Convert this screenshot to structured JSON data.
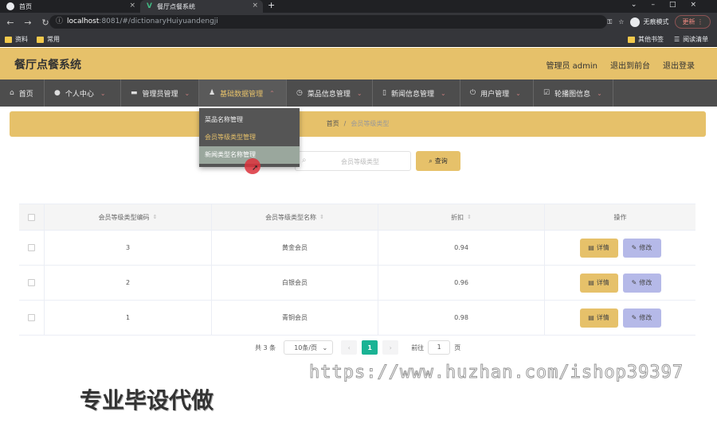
{
  "browser": {
    "tabs": [
      {
        "title": "首页"
      },
      {
        "title": "餐厅点餐系统"
      }
    ],
    "url_host": "localhost",
    "url_path": ":8081/#/dictionaryHuiyuandengji",
    "incognito_label": "无痕模式",
    "update_label": "更新",
    "bookmarks": [
      "资料",
      "常用"
    ],
    "bookmarks_right": [
      "其他书签",
      "阅读清单"
    ]
  },
  "app": {
    "title": "餐厅点餐系统",
    "header_links": [
      "管理员 admin",
      "退出到前台",
      "退出登录"
    ]
  },
  "nav": {
    "items": [
      {
        "label": "首页",
        "icon": "home-icon"
      },
      {
        "label": "个人中心",
        "icon": "user-icon"
      },
      {
        "label": "管理员管理",
        "icon": "briefcase-icon"
      },
      {
        "label": "基础数据管理",
        "icon": "person-icon"
      },
      {
        "label": "菜品信息管理",
        "icon": "clock-icon"
      },
      {
        "label": "新闻信息管理",
        "icon": "phone-icon"
      },
      {
        "label": "用户管理",
        "icon": "power-icon"
      },
      {
        "label": "轮播图信息",
        "icon": "check-icon"
      }
    ]
  },
  "dropdown": {
    "items": [
      "菜品名称管理",
      "会员等级类型管理",
      "新闻类型名称管理"
    ]
  },
  "breadcrumb": {
    "home": "首页",
    "separator": "/",
    "current": "会员等级类型"
  },
  "search": {
    "placeholder": "会员等级类型",
    "button_label": "查询"
  },
  "table": {
    "columns": [
      "会员等级类型编码",
      "会员等级类型名称",
      "折扣",
      "操作"
    ],
    "rows": [
      {
        "code": "3",
        "name": "黄金会员",
        "discount": "0.94"
      },
      {
        "code": "2",
        "name": "白银会员",
        "discount": "0.96"
      },
      {
        "code": "1",
        "name": "青铜会员",
        "discount": "0.98"
      }
    ],
    "detail_label": "详情",
    "edit_label": "修改"
  },
  "pagination": {
    "total": "共 3 条",
    "page_size": "10条/页",
    "current_page": "1",
    "goto_label": "前往",
    "goto_value": "1",
    "page_suffix": "页"
  },
  "watermark": {
    "url": "https://www.huzhan.com/ishop39397",
    "text": "专业毕设代做"
  },
  "colors": {
    "accent": "#e6c16a",
    "nav_bg": "#4d4d4d",
    "edit_btn": "#b5b9e8",
    "page_active": "#1ab394"
  }
}
